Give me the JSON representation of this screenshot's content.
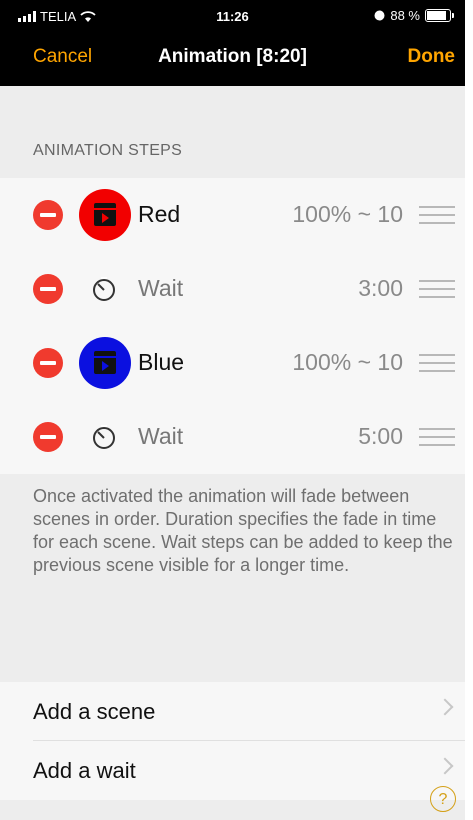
{
  "status_bar": {
    "carrier": "TELIA",
    "time": "11:26",
    "battery": "88 %"
  },
  "nav": {
    "cancel_label": "Cancel",
    "title": "Animation [8:20]",
    "done_label": "Done"
  },
  "section_header": "ANIMATION STEPS",
  "steps": [
    {
      "type": "scene",
      "name": "Red",
      "value": "100% ~ 10",
      "color": "#f20000"
    },
    {
      "type": "wait",
      "name": "Wait",
      "value": "3:00"
    },
    {
      "type": "scene",
      "name": "Blue",
      "value": "100% ~ 10",
      "color": "#0b10e0"
    },
    {
      "type": "wait",
      "name": "Wait",
      "value": "5:00"
    }
  ],
  "description": "Once activated the animation will fade between scenes in order. Duration specifies the fade in time for each scene. Wait steps can be added to keep the previous scene visible for a longer time.",
  "actions": {
    "add_scene": "Add a scene",
    "add_wait": "Add a wait"
  },
  "help_label": "?",
  "colors": {
    "accent": "#ffa500",
    "delete": "#f03a2e"
  }
}
